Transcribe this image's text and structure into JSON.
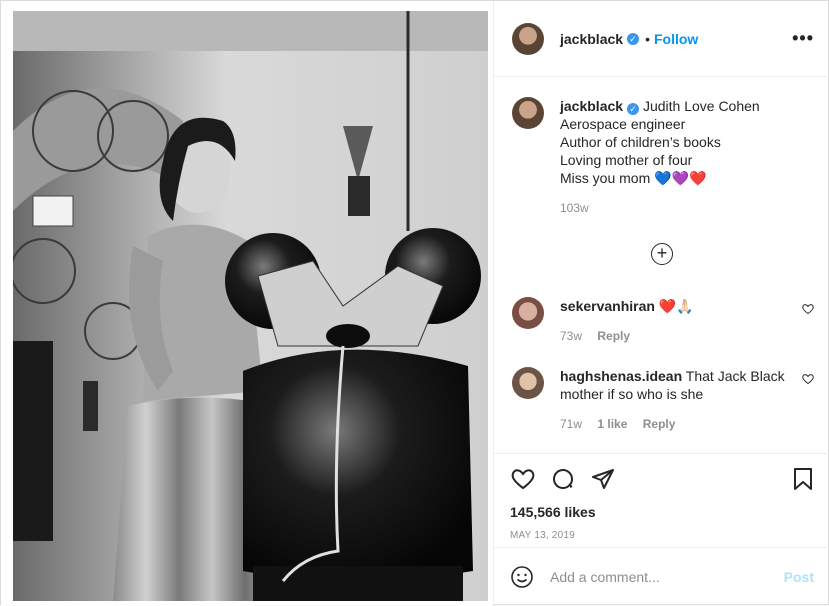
{
  "post": {
    "username": "jackblack",
    "follow_label": "Follow",
    "separator": "•",
    "more_label": "•••"
  },
  "caption": {
    "lines": [
      "Judith Love Cohen",
      "Aerospace engineer",
      "Author of children’s books",
      "Loving mother of four",
      "Miss you mom 💙💜❤️"
    ],
    "time": "103w"
  },
  "load_more_icon": "plus-circle-icon",
  "comments": [
    {
      "username": "sekervanhiran",
      "text": "❤️🙏🏻",
      "time": "73w",
      "likes": "",
      "reply": "Reply"
    },
    {
      "username": "haghshenas.idean",
      "text": "That Jack Black mother if so who is she",
      "time": "71w",
      "likes": "1 like",
      "reply": "Reply"
    }
  ],
  "likes": "145,566 likes",
  "date": "MAY 13, 2019",
  "add_comment": {
    "placeholder": "Add a comment...",
    "post_label": "Post"
  },
  "colors": {
    "accent": "#0095f6",
    "post_disabled": "#b2dffc",
    "verified": "#3897f0"
  }
}
